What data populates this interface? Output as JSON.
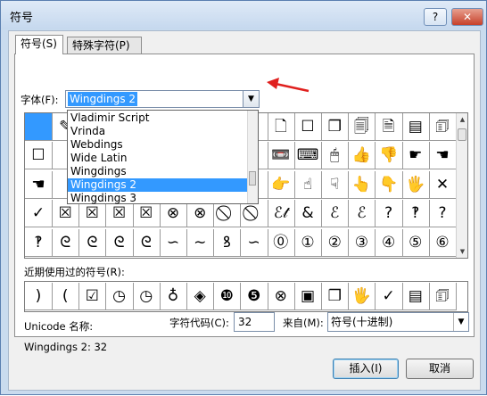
{
  "window": {
    "title": "符号",
    "help_label": "?",
    "close_label": "✕"
  },
  "tabs": [
    {
      "label": "符号(S)"
    },
    {
      "label": "特殊字符(P)"
    }
  ],
  "font": {
    "label": "字体(F):",
    "value": "Wingdings 2"
  },
  "dropdown": {
    "items": [
      "Vladimir Script",
      "Vrinda",
      "Webdings",
      "Wide Latin",
      "Wingdings",
      "Wingdings 2",
      "Wingdings 3"
    ],
    "selected_index": 5
  },
  "grid": {
    "rows": [
      [
        "",
        "✎",
        "",
        "",
        "",
        "",
        "",
        "",
        "",
        "🗋",
        "☐",
        "❐",
        "🗐",
        "🗎",
        "▤",
        "🗊"
      ],
      [
        "☐",
        "",
        "",
        "",
        "",
        "",
        "",
        "",
        "",
        "📼",
        "⌨",
        "🖱",
        "👍",
        "👎",
        "☛",
        "☚"
      ],
      [
        "☚",
        "",
        "",
        "",
        "",
        "",
        "",
        "",
        "",
        "👉",
        "☝",
        "☟",
        "👆",
        "👇",
        "🖐",
        "✕"
      ],
      [
        "✓",
        "☒",
        "☒",
        "☒",
        "☒",
        "⊗",
        "⊗",
        "⃠",
        "⃠",
        "ℰ𝓉",
        "&",
        "ℰ",
        "ℰ",
        "?",
        "‽",
        "?"
      ],
      [
        "‽",
        "ᘓ",
        "ᘓ",
        "ᘓ",
        "ᘓ",
        "∽",
        "∼",
        "ꝸ",
        "∽",
        "⓪",
        "①",
        "②",
        "③",
        "④",
        "⑤",
        "⑥"
      ]
    ]
  },
  "recent": {
    "label": "近期使用过的符号(R):",
    "symbols": [
      ")",
      "(",
      "☑",
      "◷",
      "◷",
      "♁",
      "◈",
      "❿",
      "❺",
      "⊗",
      "▣",
      "❐",
      "🖐",
      "✓",
      "▤",
      "🗊"
    ]
  },
  "unicode": {
    "name_label": "Unicode 名称:",
    "name_value": "Wingdings 2: 32"
  },
  "char_code": {
    "label": "字符代码(C):",
    "value": "32"
  },
  "from": {
    "label": "来自(M):",
    "value": "符号(十进制)"
  },
  "buttons": {
    "insert": "插入(I)",
    "cancel": "取消"
  }
}
